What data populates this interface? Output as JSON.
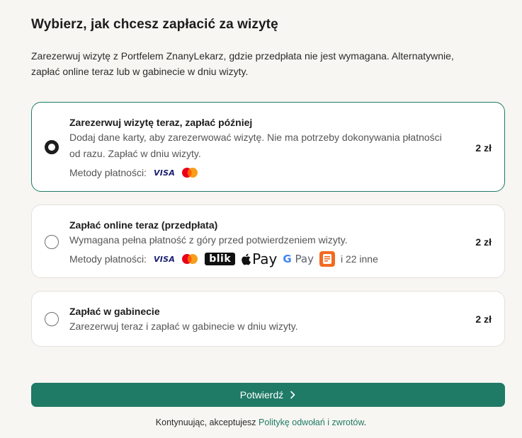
{
  "page": {
    "title": "Wybierz, jak chcesz zapłacić za wizytę",
    "subtitle": "Zarezerwuj wizytę z Portfelem ZnanyLekarz, gdzie przedpłata nie jest wymagana. Alternatywnie, zapłać online teraz lub w gabinecie w dniu wizyty."
  },
  "options": [
    {
      "title": "Zarezerwuj wizytę teraz, zapłać później",
      "description": "Dodaj dane karty, aby zarezerwować wizytę. Nie ma potrzeby dokonywania płatności od razu. Zapłać w dniu wizyty.",
      "methods_label": "Metody płatności:",
      "price": "2 zł",
      "selected": true
    },
    {
      "title": "Zapłać online teraz (przedpłata)",
      "description": "Wymagana pełna płatność z góry przed potwierdzeniem wizyty.",
      "methods_label": "Metody płatności:",
      "more_methods": "i 22 inne",
      "price": "2 zł",
      "selected": false
    },
    {
      "title": "Zapłać w gabinecie",
      "description": "Zarezerwuj teraz i zapłać w gabinecie w dniu wizyty.",
      "price": "2 zł",
      "selected": false
    }
  ],
  "payment_logos": {
    "visa": "VISA",
    "blik": "blik",
    "apple_pay": "Pay",
    "google_pay_g": "G",
    "google_pay": "Pay"
  },
  "confirm_button": {
    "label": "Potwierdź",
    "icon": "chevron-right-icon"
  },
  "footer": {
    "prefix": "Kontynuując, akceptujesz",
    "link": "Politykę odwołań i zwrotów",
    "suffix": "."
  },
  "colors": {
    "accent": "#1f7a66",
    "selected_border": "#1e7a67",
    "background": "#f8f6f2"
  }
}
